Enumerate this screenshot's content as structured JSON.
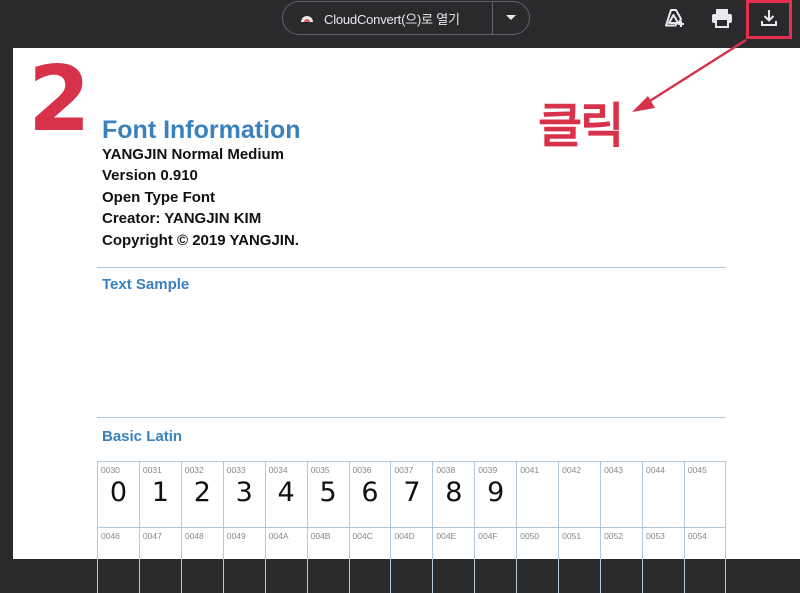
{
  "toolbar": {
    "open_with_label": "CloudConvert(으)로 열기",
    "icons": [
      "cloudconvert-icon",
      "chevron-down-icon",
      "add-to-drive-icon",
      "print-icon",
      "download-icon"
    ]
  },
  "annotations": {
    "step_number": "2",
    "click_label": "클릭",
    "accent_color": "#d8314a"
  },
  "document": {
    "title": "Font Information",
    "info": [
      "YANGJIN Normal Medium",
      "Version 0.910",
      "Open Type Font",
      "Creator: YANGJIN KIM",
      "Copyright © 2019 YANGJIN."
    ],
    "sections": {
      "text_sample": "Text Sample",
      "basic_latin": "Basic Latin"
    },
    "glyph_rows": [
      [
        {
          "code": "0030",
          "glyph": "0"
        },
        {
          "code": "0031",
          "glyph": "1"
        },
        {
          "code": "0032",
          "glyph": "2"
        },
        {
          "code": "0033",
          "glyph": "3"
        },
        {
          "code": "0034",
          "glyph": "4"
        },
        {
          "code": "0035",
          "glyph": "5"
        },
        {
          "code": "0036",
          "glyph": "6"
        },
        {
          "code": "0037",
          "glyph": "7"
        },
        {
          "code": "0038",
          "glyph": "8"
        },
        {
          "code": "0039",
          "glyph": "9"
        },
        {
          "code": "0041",
          "glyph": ""
        },
        {
          "code": "0042",
          "glyph": ""
        },
        {
          "code": "0043",
          "glyph": ""
        },
        {
          "code": "0044",
          "glyph": ""
        },
        {
          "code": "0045",
          "glyph": ""
        }
      ],
      [
        {
          "code": "0046",
          "glyph": ""
        },
        {
          "code": "0047",
          "glyph": ""
        },
        {
          "code": "0048",
          "glyph": ""
        },
        {
          "code": "0049",
          "glyph": ""
        },
        {
          "code": "004A",
          "glyph": ""
        },
        {
          "code": "004B",
          "glyph": ""
        },
        {
          "code": "004C",
          "glyph": ""
        },
        {
          "code": "004D",
          "glyph": ""
        },
        {
          "code": "004E",
          "glyph": ""
        },
        {
          "code": "004F",
          "glyph": ""
        },
        {
          "code": "0050",
          "glyph": ""
        },
        {
          "code": "0051",
          "glyph": ""
        },
        {
          "code": "0052",
          "glyph": ""
        },
        {
          "code": "0053",
          "glyph": ""
        },
        {
          "code": "0054",
          "glyph": ""
        }
      ]
    ]
  }
}
